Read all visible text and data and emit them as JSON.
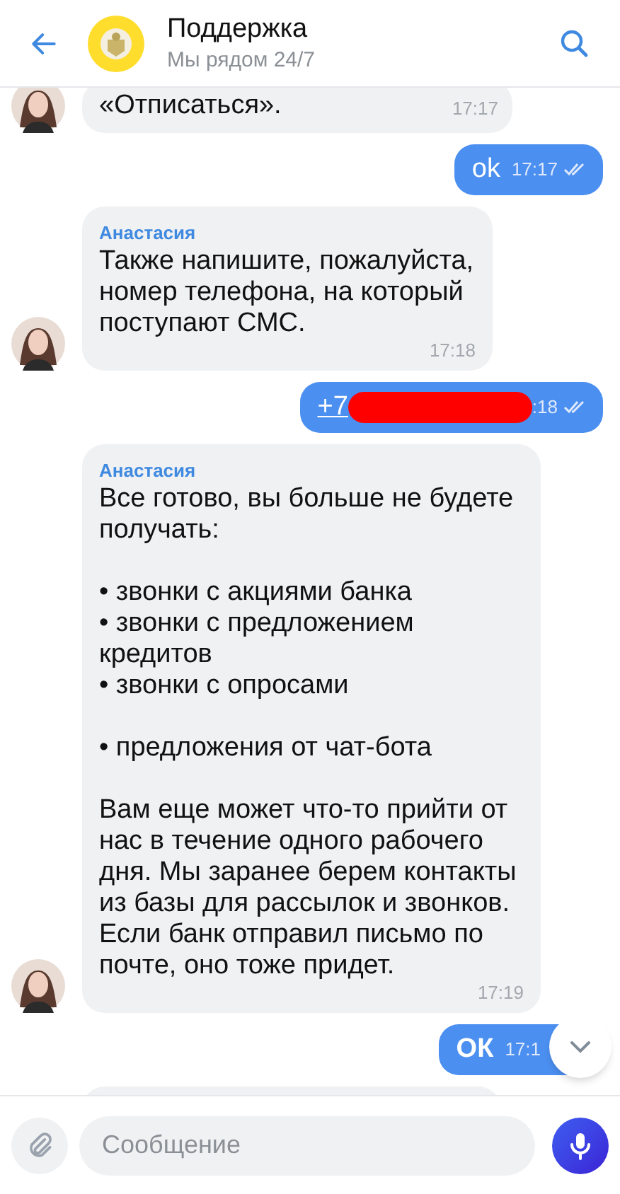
{
  "header": {
    "title": "Поддержка",
    "subtitle": "Мы рядом 24/7"
  },
  "messages": [
    {
      "kind": "incoming",
      "text": "«Отписаться».",
      "time": "17:17",
      "avatar": true
    },
    {
      "kind": "outgoing",
      "text": "ok",
      "time": "17:17",
      "read": true
    },
    {
      "kind": "incoming",
      "sender": "Анастасия",
      "text": "Также напишите, пожалуйста, номер телефона, на который поступают СМС.",
      "time": "17:18",
      "avatar": true
    },
    {
      "kind": "phone",
      "text": "+7",
      "time": ":18",
      "read": true
    },
    {
      "kind": "incoming",
      "sender": "Анастасия",
      "text": "Все готово, вы больше не будете получать:\n\n• звонки с акциями банка\n• звонки с предложением кредитов\n• звонки с опросами\n\n• предложения от чат-бота\n\nВам еще может что-то прийти от нас в течение одного рабочего дня. Мы заранее берем контакты из базы для рассылок и звонков. Если банк отправил письмо по почте, оно тоже придет.",
      "time": "17:19",
      "avatar": true
    },
    {
      "kind": "outgoing",
      "text": "ОК",
      "time": "17:1",
      "bold": true
    },
    {
      "kind": "stub"
    }
  ],
  "composer": {
    "placeholder": "Сообщение"
  }
}
